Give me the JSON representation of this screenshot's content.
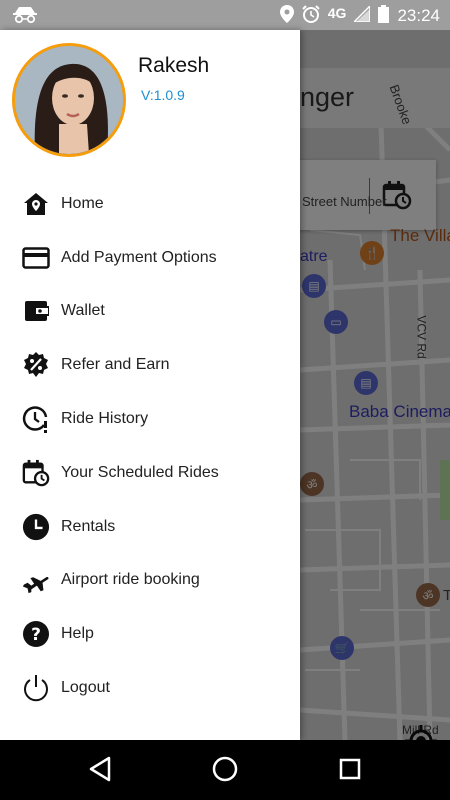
{
  "status_bar": {
    "network": "4G",
    "time": "23:24",
    "icons": [
      "incognito-icon",
      "location-icon",
      "alarm-icon",
      "signal-icon",
      "battery-icon"
    ]
  },
  "map": {
    "title_partial": "nger",
    "street_labels": [
      "Street Number",
      "atre",
      "The Villa",
      "Baba Cinema",
      "VCV Rd",
      "Brooke",
      "Mill Rd",
      "T"
    ]
  },
  "drawer": {
    "user_name": "Rakesh",
    "version": "V:1.0.9",
    "menu": [
      {
        "label": "Home",
        "icon": "home-icon"
      },
      {
        "label": "Add Payment Options",
        "icon": "credit-card-icon"
      },
      {
        "label": "Wallet",
        "icon": "wallet-icon"
      },
      {
        "label": "Refer and Earn",
        "icon": "discount-badge-icon"
      },
      {
        "label": "Ride History",
        "icon": "history-clock-icon"
      },
      {
        "label": "Your Scheduled Rides",
        "icon": "calendar-clock-icon"
      },
      {
        "label": "Rentals",
        "icon": "clock-icon"
      },
      {
        "label": "Airport ride booking",
        "icon": "airplane-icon"
      },
      {
        "label": "Help",
        "icon": "help-icon"
      },
      {
        "label": "Logout",
        "icon": "power-icon"
      }
    ]
  },
  "colors": {
    "accent": "#1e8fd1",
    "avatar_border": "#f59d0c",
    "status_bar": "#9e9e9e"
  },
  "nav_bar": {
    "buttons": [
      "back-icon",
      "home-circle-icon",
      "recents-icon"
    ]
  }
}
